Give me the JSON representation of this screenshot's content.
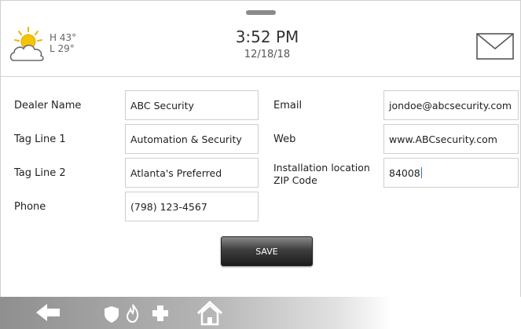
{
  "weather": {
    "high": "H 43°",
    "low": "L 29°",
    "icon": "partly-sunny-icon"
  },
  "clock": {
    "time": "3:52 PM",
    "date": "12/18/18"
  },
  "form": {
    "dealer_name_label": "Dealer Name",
    "dealer_name_value": "ABC Security",
    "tag_line_1_label": "Tag Line 1",
    "tag_line_1_value": "Automation & Security",
    "tag_line_2_label": "Tag Line 2",
    "tag_line_2_value": "Atlanta's Preferred",
    "phone_label": "Phone",
    "phone_value": "(798) 123-4567",
    "email_label": "Email",
    "email_value": "jondoe@abcsecurity.com",
    "web_label": "Web",
    "web_value": "www.ABCsecurity.com",
    "zip_label": "Installation location ZIP Code",
    "zip_value": "84008",
    "save_label": "SAVE"
  },
  "bottom_nav": {
    "icons": [
      "back-arrow-icon",
      "shield-icon",
      "fire-icon",
      "medical-cross-icon",
      "home-icon"
    ]
  }
}
